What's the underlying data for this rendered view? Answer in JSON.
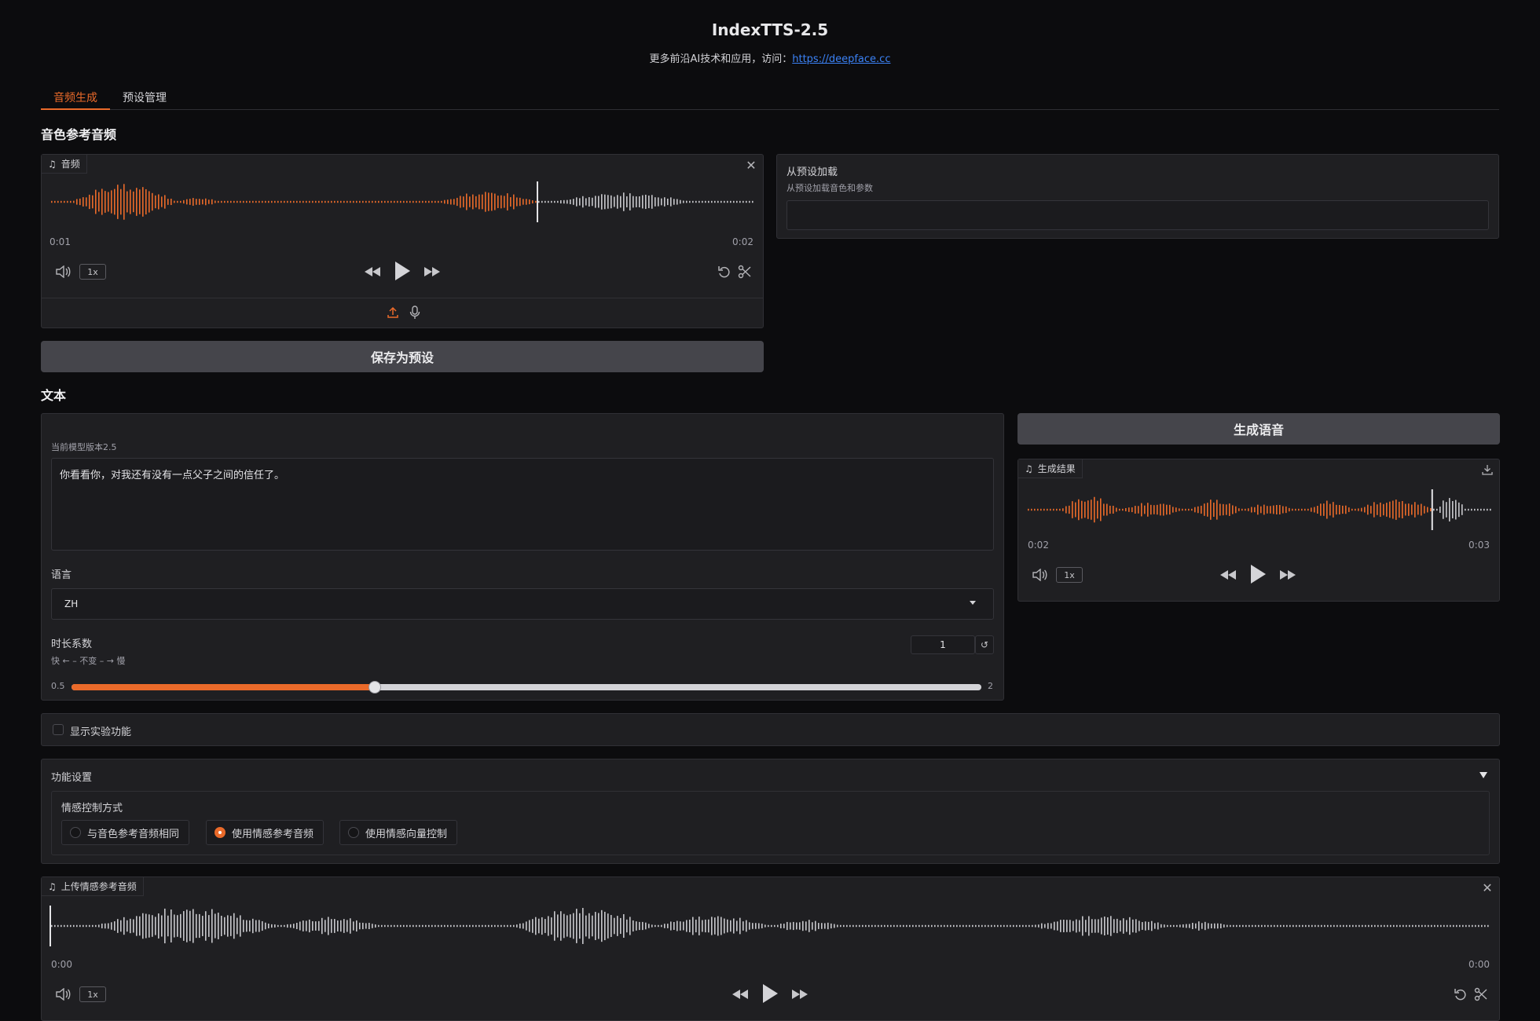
{
  "header": {
    "title": "IndexTTS-2.5",
    "subtitle_prefix": "更多前沿AI技术和应用，访问：",
    "subtitle_link": "https://deepface.cc"
  },
  "tabs": [
    {
      "label": "音频生成",
      "active": true
    },
    {
      "label": "预设管理",
      "active": false
    }
  ],
  "reference_section": {
    "label": "音色参考音频",
    "audio": {
      "chip_label": "音频",
      "time_current": "0:01",
      "time_total": "0:02",
      "rate": "1x",
      "progress": 0.69
    },
    "save_button": "保存为预设"
  },
  "preset_load": {
    "title": "从预设加载",
    "description": "从预设加载音色和参数",
    "value": ""
  },
  "text_section": {
    "label": "文本",
    "model_version": "当前模型版本2.5",
    "text_value": "你看看你，对我还有没有一点父子之间的信任了。",
    "language_label": "语言",
    "language_value": "ZH",
    "duration_label": "时长系数",
    "duration_hint": "快 ← – 不变 – → 慢",
    "duration_value": "1",
    "slider_min": "0.5",
    "slider_max": "2",
    "slider_fraction": 0.333
  },
  "generate": {
    "button": "生成语音",
    "result": {
      "chip_label": "生成结果",
      "time_current": "0:02",
      "time_total": "0:03",
      "rate": "1x",
      "progress": 0.87
    }
  },
  "experimental": {
    "label": "显示实验功能",
    "checked": false
  },
  "settings": {
    "title": "功能设置",
    "emotion_label": "情感控制方式",
    "options": [
      {
        "label": "与音色参考音频相同",
        "selected": false
      },
      {
        "label": "使用情感参考音频",
        "selected": true
      },
      {
        "label": "使用情感向量控制",
        "selected": false
      }
    ]
  },
  "emotion_audio": {
    "chip_label": "上传情感参考音频",
    "time_current": "0:00",
    "time_total": "0:00",
    "rate": "1x",
    "progress": 0
  },
  "colors": {
    "accent": "#ea6a2a",
    "played": "#ea6a2a",
    "unplayed": "#c8c8cc",
    "link": "#3b82f6"
  },
  "icons": {
    "music": "music-note-icon",
    "close": "close-icon",
    "volume": "volume-icon",
    "rewind": "rewind-icon",
    "play": "play-icon",
    "forward": "fast-forward-icon",
    "undo": "undo-icon",
    "trim": "scissors-icon",
    "upload": "upload-icon",
    "mic": "microphone-icon",
    "download": "download-icon",
    "reset": "reset-icon",
    "collapse": "triangle-down-icon"
  }
}
